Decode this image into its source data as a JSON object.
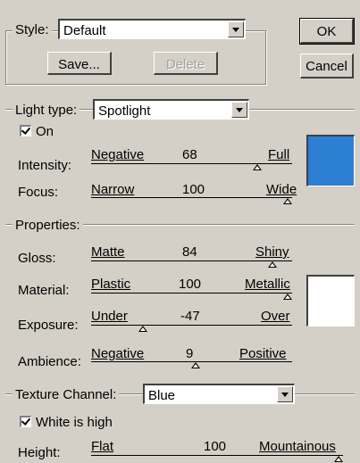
{
  "style_group": {
    "label": "Style:",
    "selected": "Default",
    "save_label": "Save...",
    "delete_label": "Delete"
  },
  "buttons": {
    "ok": "OK",
    "cancel": "Cancel"
  },
  "light": {
    "label": "Light type:",
    "selected": "Spotlight",
    "on_label": "On",
    "on_checked": true,
    "color": "#2d7fd3",
    "sliders": {
      "intensity": {
        "label": "Intensity:",
        "min": "Negative",
        "value": "68",
        "max": "Full"
      },
      "focus": {
        "label": "Focus:",
        "min": "Narrow",
        "value": "100",
        "max": "Wide"
      }
    }
  },
  "properties": {
    "title": "Properties:",
    "color": "#ffffff",
    "sliders": {
      "gloss": {
        "label": "Gloss:",
        "min": "Matte",
        "value": "84",
        "max": "Shiny"
      },
      "material": {
        "label": "Material:",
        "min": "Plastic",
        "value": "100",
        "max": "Metallic"
      },
      "exposure": {
        "label": "Exposure:",
        "min": "Under",
        "value": "-47",
        "max": "Over"
      },
      "ambience": {
        "label": "Ambience:",
        "min": "Negative",
        "value": "9",
        "max": "Positive"
      }
    }
  },
  "texture": {
    "label": "Texture Channel:",
    "selected": "Blue",
    "white_high_label": "White is high",
    "white_high_checked": true,
    "height": {
      "label": "Height:",
      "min": "Flat",
      "value": "100",
      "max": "Mountainous"
    }
  }
}
